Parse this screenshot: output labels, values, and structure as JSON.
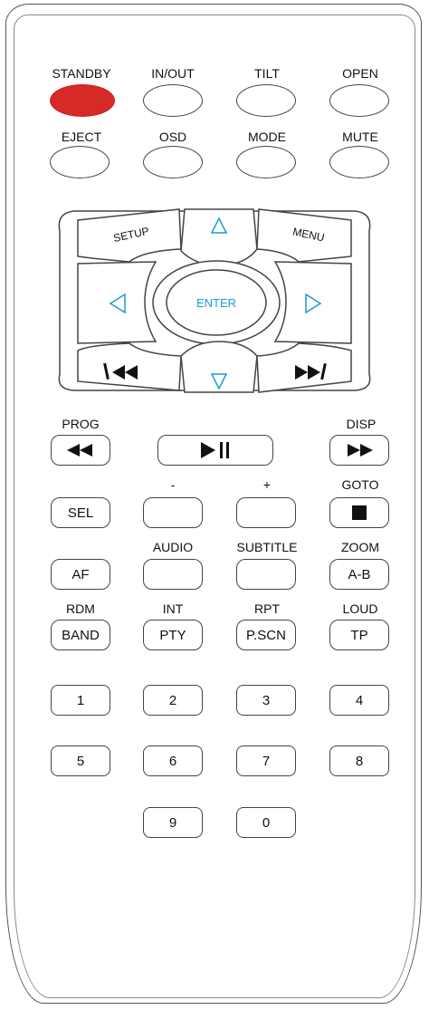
{
  "top_row_labels": [
    "STANDBY",
    "IN/OUT",
    "TILT",
    "OPEN"
  ],
  "second_row_labels": [
    "EJECT",
    "OSD",
    "MODE",
    "MUTE"
  ],
  "dpad": {
    "setup": "SETUP",
    "menu": "MENU",
    "enter": "ENTER",
    "up_icon": "triangle-up",
    "down_icon": "triangle-down",
    "left_icon": "triangle-left",
    "right_icon": "triangle-right",
    "prev_icon": "skip-back",
    "next_icon": "skip-forward",
    "accent_color": "#1a9bd7"
  },
  "transport": {
    "prog_label": "PROG",
    "disp_label": "DISP",
    "rewind_icon": "rewind",
    "play_pause_icon": "play-pause",
    "forward_icon": "fast-forward"
  },
  "row_sel": {
    "minus_label": "-",
    "plus_label": "+",
    "goto_label": "GOTO",
    "sel_button": "SEL",
    "stop_icon": "stop-square"
  },
  "row_af": {
    "audio_label": "AUDIO",
    "subtitle_label": "SUBTITLE",
    "zoom_label": "ZOOM",
    "af_button": "AF",
    "ab_button": "A-B"
  },
  "row_band": {
    "rdm_label": "RDM",
    "int_label": "INT",
    "rpt_label": "RPT",
    "loud_label": "LOUD",
    "band_button": "BAND",
    "pty_button": "PTY",
    "pscn_button": "P.SCN",
    "tp_button": "TP"
  },
  "numbers": [
    "1",
    "2",
    "3",
    "4",
    "5",
    "6",
    "7",
    "8",
    "9",
    "0"
  ],
  "standby_color": "#d52a25"
}
